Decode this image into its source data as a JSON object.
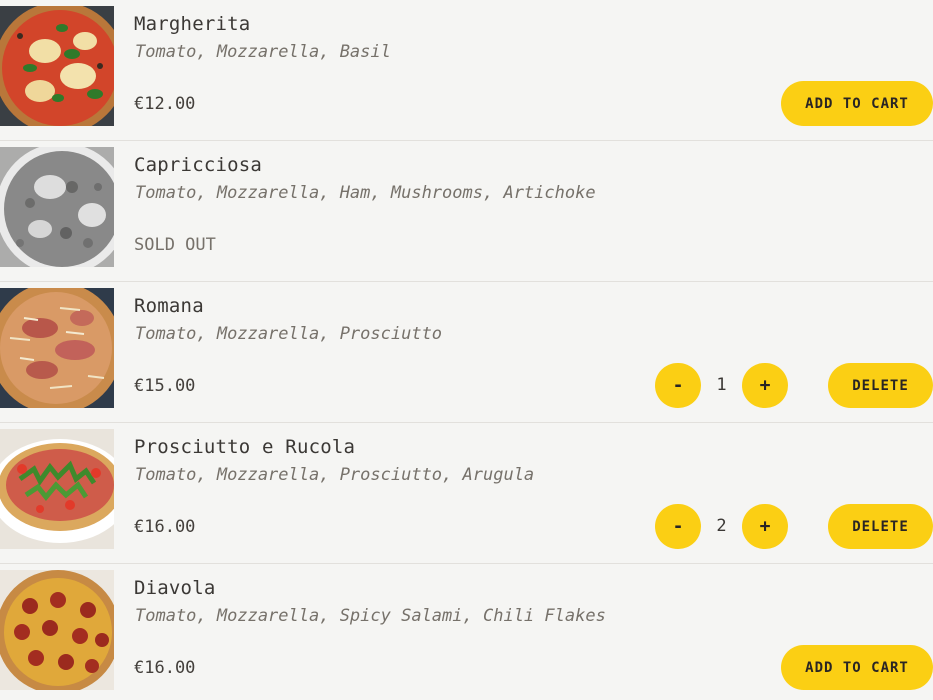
{
  "items": [
    {
      "name": "Margherita",
      "ingredients": "Tomato, Mozzarella, Basil",
      "price": "€12.00",
      "action_label": "Add to cart"
    },
    {
      "name": "Capricciosa",
      "ingredients": "Tomato, Mozzarella, Ham, Mushrooms, Artichoke",
      "status": "Sold out"
    },
    {
      "name": "Romana",
      "ingredients": "Tomato, Mozzarella, Prosciutto",
      "price": "€15.00",
      "minus_label": "-",
      "quantity": "1",
      "plus_label": "+",
      "action_label": "Delete"
    },
    {
      "name": "Prosciutto e Rucola",
      "ingredients": "Tomato, Mozzarella, Prosciutto, Arugula",
      "price": "€16.00",
      "minus_label": "-",
      "quantity": "2",
      "plus_label": "+",
      "action_label": "Delete"
    },
    {
      "name": "Diavola",
      "ingredients": "Tomato, Mozzarella, Spicy Salami, Chili Flakes",
      "price": "€16.00",
      "action_label": "Add to cart"
    }
  ],
  "colors": {
    "accent": "#fbcf14",
    "background": "#f5f5f3",
    "text": "#44403c",
    "muted": "#76716a"
  }
}
